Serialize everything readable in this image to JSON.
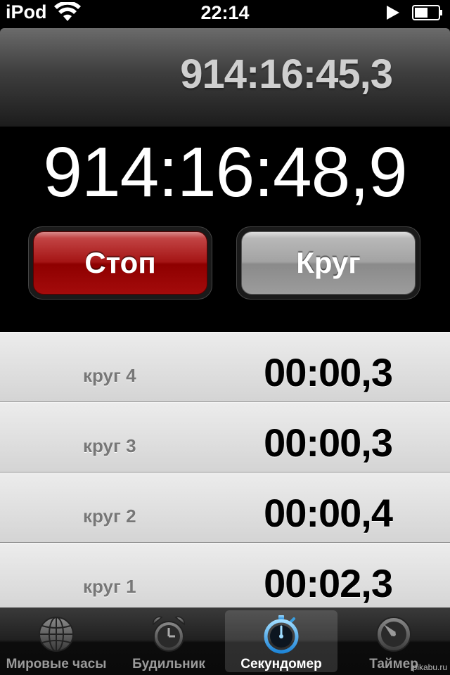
{
  "status_bar": {
    "carrier": "iPod",
    "time": "22:14",
    "wifi_icon": "wifi-icon",
    "play_icon": "play-icon",
    "battery_icon": "battery-icon"
  },
  "stopwatch": {
    "current_lap_time": "914:16:45,3",
    "total_time": "914:16:48,9"
  },
  "buttons": {
    "stop_label": "Стоп",
    "lap_label": "Круг",
    "stop_color": "#a51515",
    "lap_color": "#a3a3a3"
  },
  "laps": [
    {
      "label": "круг 4",
      "time": "00:00,3"
    },
    {
      "label": "круг 3",
      "time": "00:00,3"
    },
    {
      "label": "круг 2",
      "time": "00:00,4"
    },
    {
      "label": "круг 1",
      "time": "00:02,3"
    }
  ],
  "tabs": [
    {
      "label": "Мировые часы",
      "icon": "globe-icon",
      "active": false
    },
    {
      "label": "Будильник",
      "icon": "alarm-clock-icon",
      "active": false
    },
    {
      "label": "Секундомер",
      "icon": "stopwatch-icon",
      "active": true
    },
    {
      "label": "Таймер",
      "icon": "timer-icon",
      "active": false
    }
  ],
  "watermark": "pikabu.ru",
  "accent_color": "#3a9fe0"
}
